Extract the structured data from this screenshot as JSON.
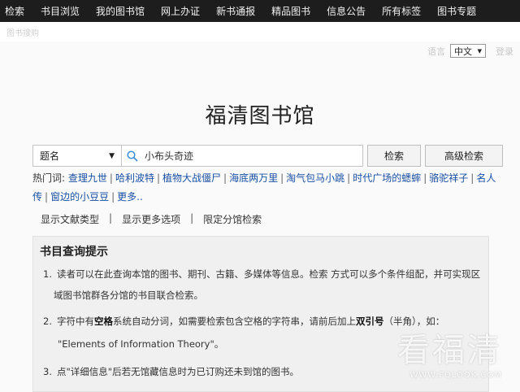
{
  "nav": {
    "items": [
      "检索",
      "书目浏览",
      "我的图书馆",
      "网上办证",
      "新书通报",
      "精品图书",
      "信息公告",
      "所有标签",
      "图书专题"
    ]
  },
  "breadcrumb": "图书搜购",
  "lang": {
    "label": "语言",
    "selected": "中文",
    "login": "登录"
  },
  "site_title": "福清图书馆",
  "search": {
    "field": "题名",
    "query": "小布头奇迹",
    "search_button": "检索",
    "advanced_button": "高级检索"
  },
  "hot": {
    "label": "热门词:",
    "words": [
      "查理九世",
      "哈利波特",
      "植物大战僵尸",
      "海底两万里",
      "淘气包马小跳",
      "时代广场的蟋蟀",
      "骆驼祥子",
      "名人传",
      "窗边的小豆豆",
      "更多.."
    ]
  },
  "options": [
    "显示文献类型",
    "显示更多选项",
    "限定分馆检索"
  ],
  "tips": {
    "title": "书目查询提示",
    "t1_num": "1.",
    "t1_line1": "读者可以在此查询本馆的图书、期刊、古籍、多媒体等信息。检索 方式可以多个条件组配，并可实现区",
    "t1_line2": "域图书馆群各分馆的书目联合检索。",
    "t2_num": "2.",
    "t2_a": "字符中有",
    "t2_b": "空格",
    "t2_c": "系统自动分词，如需要检索包含空格的字符串，请前后加上",
    "t2_d": "双引号",
    "t2_e": "（半角），如：",
    "t2_line2": "\"Elements of Information Theory\"。",
    "t3_num": "3.",
    "t3_text": "点\"详细信息\"后若无馆藏信息时为已订购还未到馆的图书。"
  },
  "watermark": {
    "brand": "看福清",
    "url": "WWW.FQLOOK.COM"
  }
}
